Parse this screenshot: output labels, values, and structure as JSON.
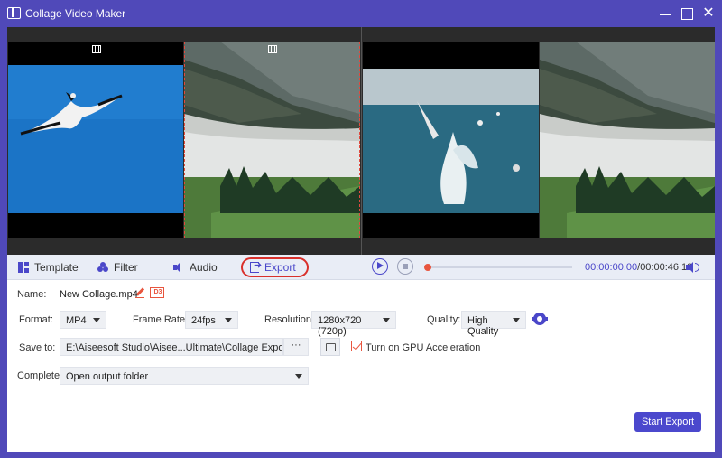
{
  "window": {
    "title": "Collage Video Maker",
    "close_glyph": "✕"
  },
  "icons": {
    "app": "collage-app-icon",
    "film": "film-icon",
    "edit": "pencil-icon",
    "id3": "id3-tag-icon",
    "gear": "gear-icon",
    "folder": "folder-icon",
    "volume": "volume-icon",
    "play": "play-icon",
    "stop": "stop-icon"
  },
  "tabs": [
    {
      "label": "Template",
      "icon": "template-grid-icon"
    },
    {
      "label": "Filter",
      "icon": "filter-drops-icon"
    },
    {
      "label": "Audio",
      "icon": "audio-speaker-icon"
    },
    {
      "label": "Export",
      "icon": "export-icon",
      "active": true
    }
  ],
  "player": {
    "current_time": "00:00:00.00",
    "separator": "/",
    "total_time": "00:00:46.12",
    "progress": 0.0
  },
  "export": {
    "name_label": "Name:",
    "name_value": "New Collage.mp4",
    "id3_text": "ID3",
    "format_label": "Format:",
    "format_value": "MP4",
    "frame_rate_label": "Frame Rate:",
    "frame_rate_value": "24fps",
    "resolution_label": "Resolution:",
    "resolution_value": "1280x720 (720p)",
    "quality_label": "Quality:",
    "quality_value": "High Quality",
    "save_to_label": "Save to:",
    "save_to_value": "E:\\Aiseesoft Studio\\Aisee...Ultimate\\Collage Exported",
    "browse_label": "···",
    "gpu_checked": true,
    "gpu_label": "Turn on GPU Acceleration",
    "complete_label": "Complete:",
    "complete_value": "Open output folder",
    "start_button": "Start Export"
  },
  "colors": {
    "accent": "#4b48cd",
    "titlebar": "#5049b9",
    "highlight_red": "#d9302b",
    "progress_thumb": "#e8553e"
  }
}
